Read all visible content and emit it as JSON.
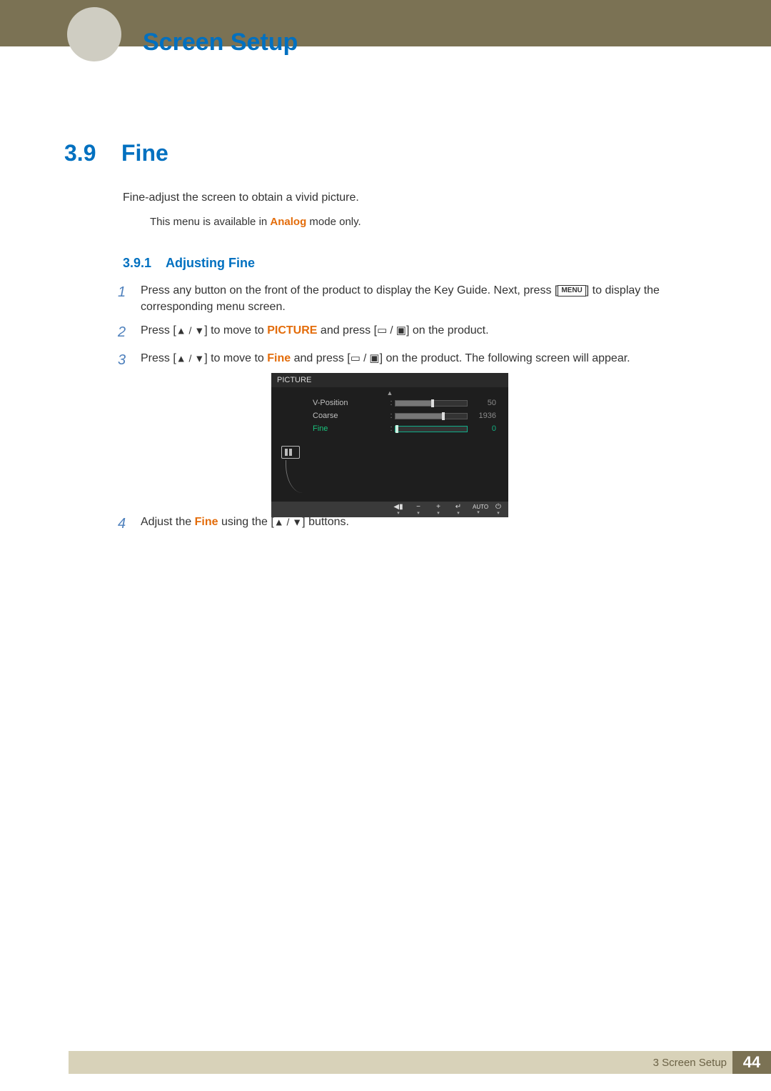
{
  "chapter": {
    "title": "Screen Setup"
  },
  "section": {
    "number": "3.9",
    "title": "Fine"
  },
  "intro": "Fine-adjust the screen to obtain a vivid picture.",
  "note": {
    "pre": "This menu is available in ",
    "analog": "Analog",
    "post": " mode only."
  },
  "subsection": {
    "number": "3.9.1",
    "title": "Adjusting Fine"
  },
  "steps": {
    "n1": "1",
    "s1a": "Press any button on the front of the product to display the Key Guide. Next, press [",
    "s1_menu": "MENU",
    "s1b": "] to display the corresponding menu screen.",
    "n2": "2",
    "s2a": "Press [",
    "s2_arrows": "▲ / ▼",
    "s2b": "] to move to ",
    "s2_picture": "PICTURE",
    "s2c": " and press [",
    "s2_src": "▭ / ▣",
    "s2d": "] on the product.",
    "n3": "3",
    "s3a": "Press [",
    "s3_arrows": "▲ / ▼",
    "s3b": "] to move to ",
    "s3_fine": "Fine",
    "s3c": " and press [",
    "s3_src": "▭ / ▣",
    "s3d": "] on the product. The following screen will appear.",
    "n4": "4",
    "s4a": "Adjust the ",
    "s4_fine": "Fine",
    "s4b": " using the [",
    "s4_arrows": "▲ / ▼",
    "s4c": "] buttons."
  },
  "osd": {
    "title": "PICTURE",
    "scrollUp": "▲",
    "rows": [
      {
        "label": "V-Position",
        "value": "50",
        "percent": 50,
        "active": false
      },
      {
        "label": "Coarse",
        "value": "1936",
        "percent": 65,
        "active": false
      },
      {
        "label": "Fine",
        "value": "0",
        "percent": 0,
        "active": true
      }
    ],
    "footer": {
      "back": {
        "sym": "◀▮",
        "dn": "▾"
      },
      "minus": {
        "sym": "−",
        "dn": "▾"
      },
      "plus": {
        "sym": "+",
        "dn": "▾"
      },
      "enter": {
        "sym": "↵",
        "dn": "▾"
      },
      "auto": {
        "sym": "AUTO",
        "dn": "▾"
      },
      "power": {
        "sym": "⏻",
        "dn": "▾"
      }
    }
  },
  "footer": {
    "chapter": "3 Screen Setup",
    "page": "44"
  }
}
